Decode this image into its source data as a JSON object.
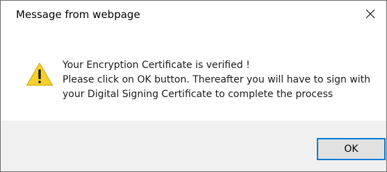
{
  "window": {
    "title": "Message from webpage"
  },
  "message": {
    "line1": "Your Encryption Certificate is verified !",
    "line2": "Please click on OK button.  Thereafter you will have to sign with",
    "line3": "your Digital Signing Certificate to complete the process"
  },
  "buttons": {
    "ok_label": "OK"
  },
  "icons": {
    "warning": "warning-icon",
    "close": "close-icon"
  },
  "colors": {
    "warning_fill": "#f7d12a",
    "focus_border": "#0078d7",
    "footer_bg": "#f0f0f0",
    "button_bg": "#e1e1e1"
  }
}
